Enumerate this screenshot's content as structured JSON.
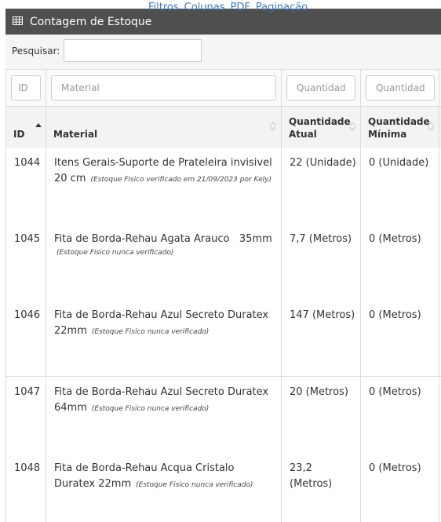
{
  "header": {
    "title": "Contagem de Estoque",
    "links": [
      "Filtros",
      "Colunas",
      "PDF",
      "Paginação"
    ]
  },
  "search": {
    "label": "Pesquisar:",
    "value": ""
  },
  "filters": {
    "id_placeholder": "ID",
    "material_placeholder": "Material",
    "qtd_atual_placeholder": "Quantidade Atual",
    "qtd_minima_placeholder": "Quantidade Mínima"
  },
  "columns": {
    "id": "ID",
    "material": "Material",
    "qtd_atual_l1": "Quantidade",
    "qtd_atual_l2": "Atual",
    "qtd_minima_l1": "Quantidade",
    "qtd_minima_l2": "Mínima"
  },
  "rows": [
    {
      "id": "1044",
      "material": "Itens Gerais-Suporte de Prateleira invisivel 20 cm",
      "note": "(Estoque Fisico verificado em 21/09/2023 por Kely)",
      "qtd_atual": "22 (Unidade)",
      "qtd_minima": "0 (Unidade)"
    },
    {
      "id": "1045",
      "material": "Fita de Borda-Rehau Agata Arauco   35mm",
      "note": "(Estoque Fisico nunca verificado)",
      "qtd_atual": "7,7 (Metros)",
      "qtd_minima": "0 (Metros)"
    },
    {
      "id": "1046",
      "material": "Fita de Borda-Rehau Azul Secreto Duratex 22mm",
      "note": "(Estoque Fisico nunca verificado)",
      "qtd_atual": "147 (Metros)",
      "qtd_minima": "0 (Metros)"
    },
    {
      "id": "1047",
      "material": "Fita de Borda-Rehau Azul Secreto Duratex 64mm",
      "note": "(Estoque Fisico nunca verificado)",
      "qtd_atual": "20 (Metros)",
      "qtd_minima": "0 (Metros)"
    },
    {
      "id": "1048",
      "material": "Fita de Borda-Rehau Acqua Cristalo Duratex 22mm",
      "note": "(Estoque Fisico nunca verificado)",
      "qtd_atual": "23,2 (Metros)",
      "qtd_minima": "0 (Metros)"
    }
  ]
}
